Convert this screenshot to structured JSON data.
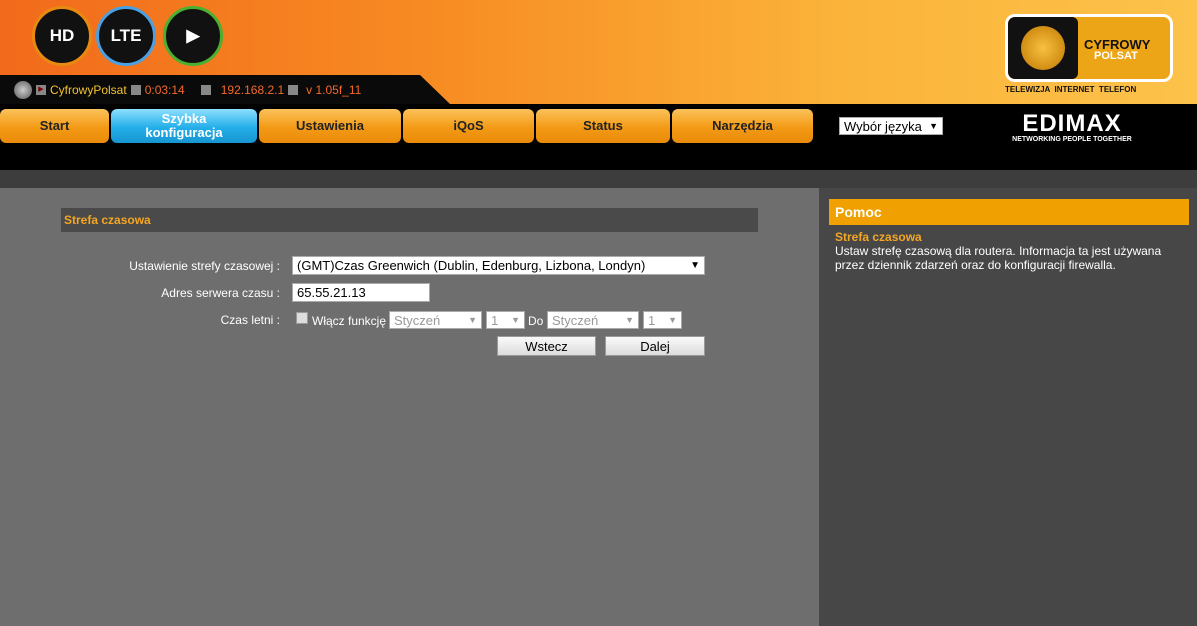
{
  "header": {
    "badges": [
      "HD",
      "LTE",
      "play"
    ],
    "status": {
      "name": "CyfrowyPolsat",
      "uptime": "0:03:14",
      "ip": "192.168.2.1",
      "version": "v 1.05f_11"
    },
    "brand": {
      "logo_line1": "CYFROWY",
      "logo_line2": "POLSAT",
      "tagline": "TELEWIZJA  INTERNET  TELEFON",
      "edimax": "EDIMAX",
      "edimax_tag": "NETWORKING PEOPLE TOGETHER"
    }
  },
  "nav": {
    "tabs": [
      {
        "label": "Start"
      },
      {
        "label": "Szybka konfiguracja"
      },
      {
        "label": "Ustawienia"
      },
      {
        "label": "iQoS"
      },
      {
        "label": "Status"
      },
      {
        "label": "Narzędzia"
      }
    ],
    "language": "Wybór języka"
  },
  "main": {
    "section_title": "Strefa czasowa",
    "timezone_label": "Ustawienie strefy czasowej :",
    "timezone_value": "(GMT)Czas Greenwich (Dublin, Edenburg, Lizbona, Londyn)",
    "server_label": "Adres serwera czasu :",
    "server_value": "65.55.21.13",
    "dst_label": "Czas letni :",
    "dst_checkbox": "Włącz funkcję",
    "dst_from_month": "Styczeń",
    "dst_from_day": "1",
    "dst_to": "Do",
    "dst_to_month": "Styczeń",
    "dst_to_day": "1",
    "back": "Wstecz",
    "next": "Dalej"
  },
  "help": {
    "title": "Pomoc",
    "subtitle": "Strefa czasowa",
    "text": "Ustaw strefę czasową dla routera. Informacja ta jest używana przez dziennik zdarzeń oraz do konfiguracji firewalla."
  },
  "colors": {
    "accent": "#f0a000",
    "active_tab": "#23aee9"
  }
}
